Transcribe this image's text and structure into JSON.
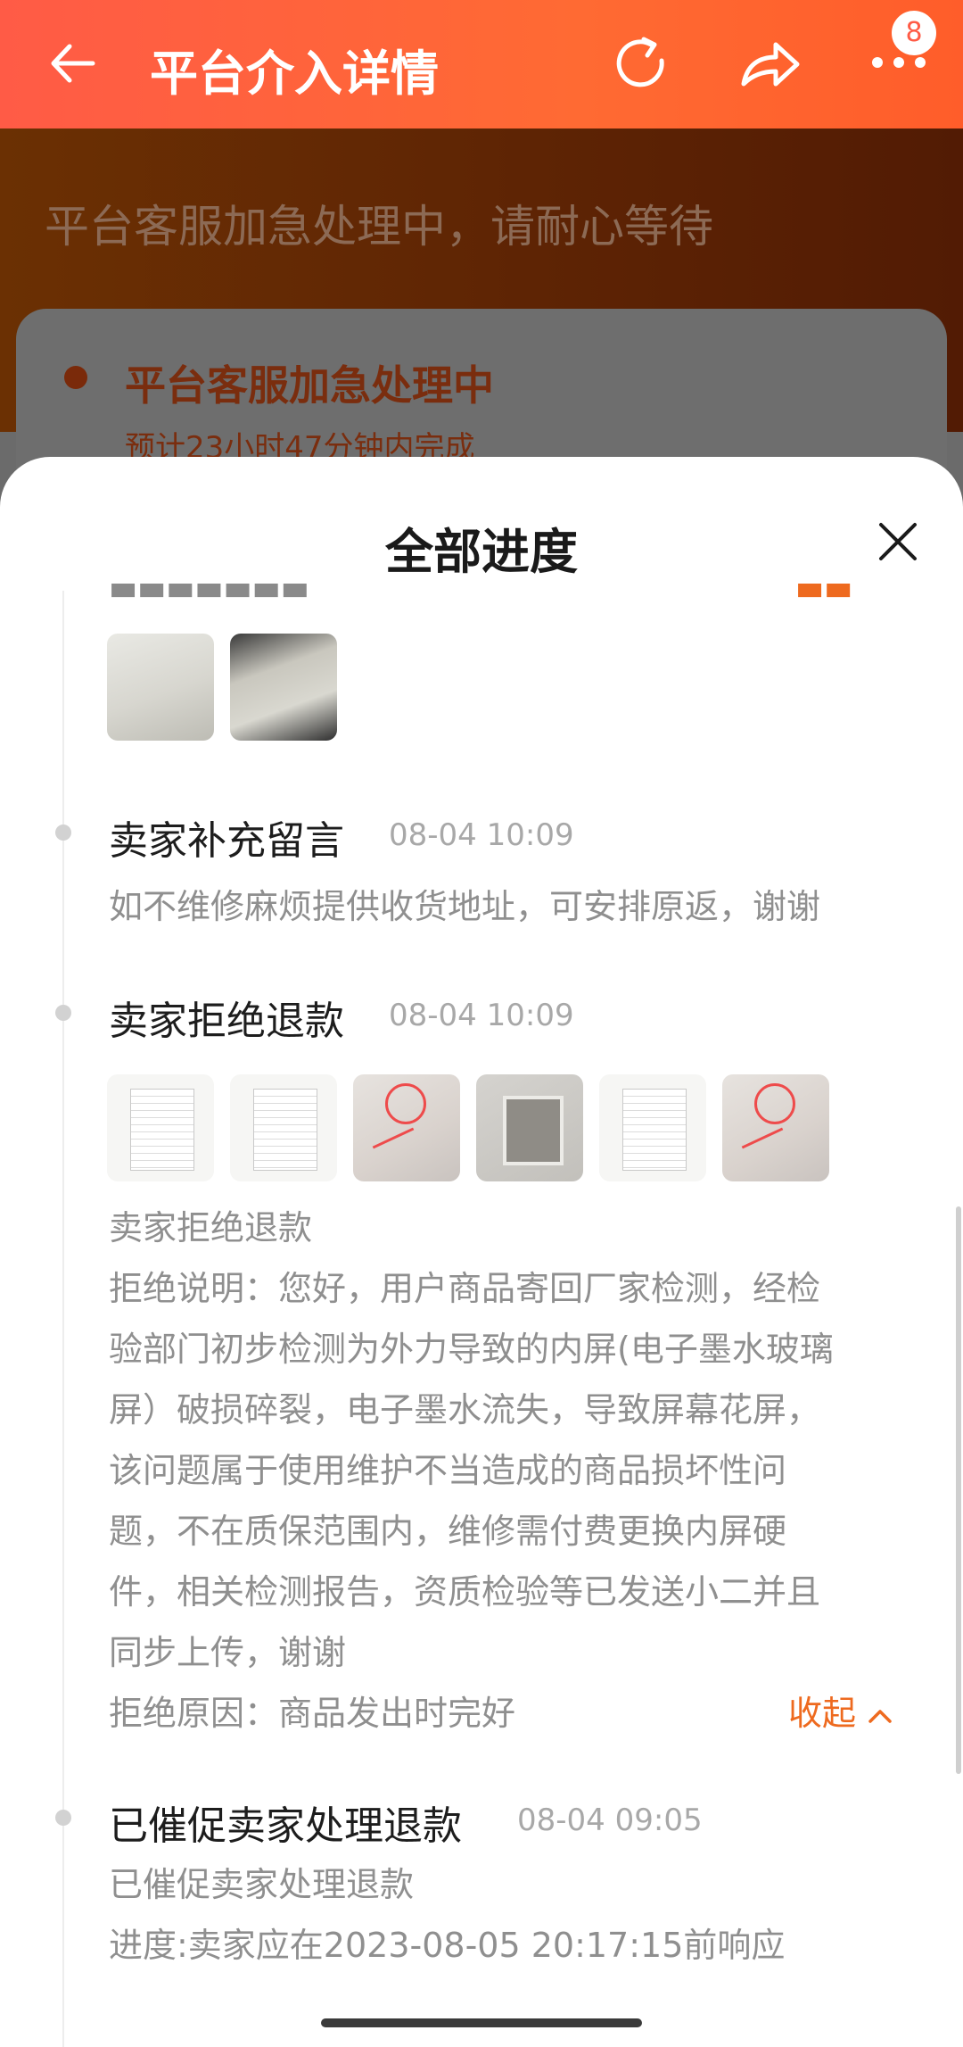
{
  "header": {
    "title": "平台介入详情",
    "badge_count": "8",
    "icons": [
      "back-arrow-icon",
      "refresh-icon",
      "share-icon",
      "more-icon"
    ]
  },
  "background_page": {
    "status_text": "平台客服加急处理中，请耐心等待",
    "card_title": "平台客服加急处理中",
    "card_subtitle": "预计23小时47分钟内完成"
  },
  "sheet": {
    "title": "全部进度",
    "events": [
      {
        "title": "卖家补充留言",
        "time": "08-04 10:09",
        "text": "如不维修麻烦提供收货地址，可安排原返，谢谢"
      },
      {
        "title": "卖家拒绝退款",
        "time": "08-04 10:09",
        "lines": [
          "卖家拒绝退款",
          "拒绝说明：您好，用户商品寄回厂家检测，经检",
          "验部门初步检测为外力导致的内屏(电子墨水玻璃",
          "屏）破损碎裂，电子墨水流失，导致屏幕花屏，",
          "该问题属于使用维护不当造成的商品损坏性问",
          "题，不在质保范围内，维修需付费更换内屏硬",
          "件，相关检测报告，资质检验等已发送小二并且",
          "同步上传，谢谢",
          "拒绝原因：商品发出时完好"
        ],
        "collapse_label": "收起"
      },
      {
        "title": "已催促卖家处理退款",
        "time": "08-04 09:05",
        "lines": [
          "已催促卖家处理退款",
          "进度:卖家应在2023-08-05 20:17:15前响应"
        ]
      }
    ]
  },
  "colors": {
    "header_orange": "#ff5b46",
    "accent_orange": "#ee6a1f",
    "secondary_text": "#8f8f8f",
    "timestamp_gray": "#a8a8a8"
  }
}
